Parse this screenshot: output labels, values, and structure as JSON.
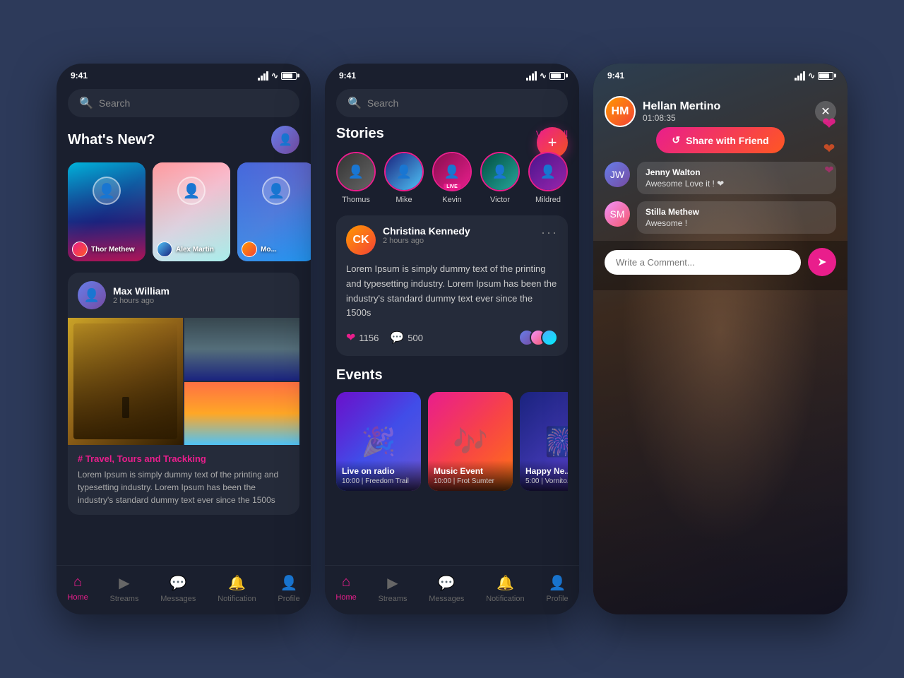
{
  "phone1": {
    "status_time": "9:41",
    "search_placeholder": "Search",
    "whats_new_title": "What's New?",
    "stories": [
      {
        "user": "Thor Methew"
      },
      {
        "user": "Alex Martin"
      },
      {
        "user": "Mo..."
      }
    ],
    "post": {
      "user": "Max William",
      "time": "2 hours ago",
      "tag": "# Travel, Tours and Trackking",
      "text": "Lorem Ipsum is simply dummy text of the printing and typesetting industry. Lorem Ipsum has been the industry's standard dummy text ever since the 1500s"
    },
    "nav": {
      "home": "Home",
      "streams": "Streams",
      "messages": "Messages",
      "notification": "Notification",
      "profile": "Profile"
    }
  },
  "phone2": {
    "status_time": "9:41",
    "search_placeholder": "Search",
    "stories_title": "Stories",
    "view_all": "View All",
    "story_circles": [
      {
        "name": "Thomus"
      },
      {
        "name": "Mike"
      },
      {
        "name": "Kevin",
        "live": true
      },
      {
        "name": "Victor"
      },
      {
        "name": "Mildred"
      }
    ],
    "post": {
      "user": "Christina Kennedy",
      "time": "2 hours ago",
      "text": "Lorem Ipsum is simply dummy text of the printing and typesetting industry. Lorem Ipsum has been the industry's standard dummy text ever since the 1500s",
      "likes": "1156",
      "comments": "500"
    },
    "events_title": "Events",
    "events": [
      {
        "name": "Live on radio",
        "time": "10:00 | Freedom Trail"
      },
      {
        "name": "Music Event",
        "time": "10:00 | Frot Sumter"
      },
      {
        "name": "Happy Ne...",
        "time": "5:00 | Vornito..."
      }
    ],
    "nav": {
      "home": "Home",
      "streams": "Streams",
      "messages": "Messages",
      "notification": "Notification",
      "profile": "Profile"
    }
  },
  "phone3": {
    "status_time": "9:41",
    "streamer": "Hellan Mertino",
    "stream_time": "01:08:35",
    "share_btn": "Share with Friend",
    "comments": [
      {
        "user": "Jenny Walton",
        "text": "Awesome Love it ! ❤"
      },
      {
        "user": "Stilla Methew",
        "text": "Awesome !"
      }
    ],
    "comment_placeholder": "Write a Comment..."
  }
}
